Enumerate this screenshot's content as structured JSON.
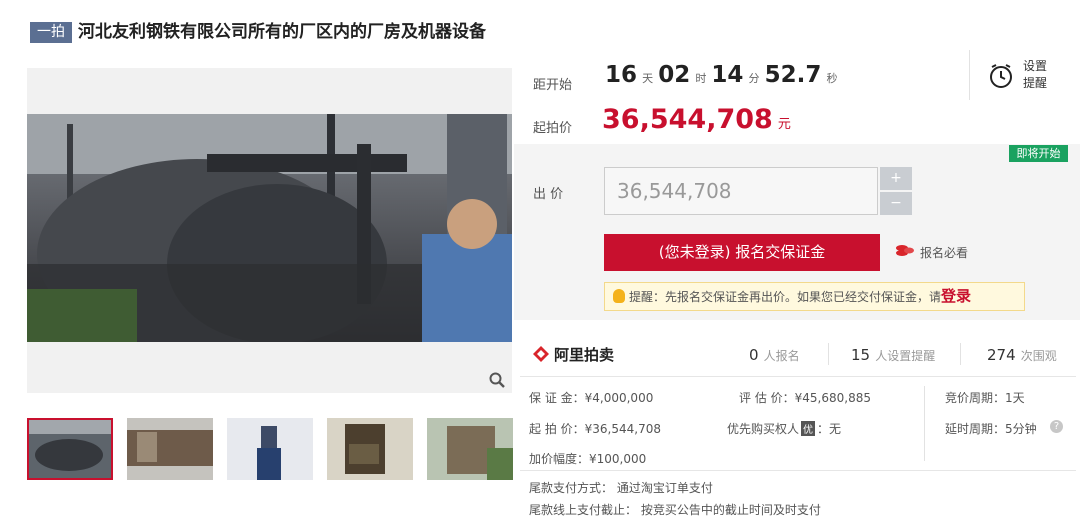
{
  "header": {
    "badge": "一拍",
    "title": "河北友利钢铁有限公司所有的厂区内的厂房及机器设备"
  },
  "countdown": {
    "label": "距开始",
    "days": "16",
    "days_unit": "天",
    "hours": "02",
    "hours_unit": "时",
    "minutes": "14",
    "minutes_unit": "分",
    "seconds": "52.7",
    "seconds_unit": "秒"
  },
  "reminder": {
    "line1": "设置",
    "line2": "提醒"
  },
  "start_price": {
    "label": "起拍价",
    "value": "36,544,708",
    "unit": "元"
  },
  "status_badge": "即将开始",
  "bid": {
    "label": "出 价",
    "input_value": "36,544,708",
    "plus": "+",
    "minus": "−"
  },
  "signup_button": "(您未登录) 报名交保证金",
  "must_read": "报名必看",
  "tip": {
    "text": "提醒：先报名交保证金再出价。如果您已经交付保证金，请",
    "login": "登录"
  },
  "brand": "阿里拍卖",
  "stats": [
    {
      "num": "0",
      "unit": "人报名"
    },
    {
      "num": "15",
      "unit": "人设置提醒"
    },
    {
      "num": "274",
      "unit": "次围观"
    }
  ],
  "info": {
    "deposit": "保 证 金：¥4,000,000",
    "appraisal": "评 估 价：¥45,680,885",
    "cycle": "竞价周期：1天",
    "start": "起 拍 价：¥36,544,708",
    "priority": "优先购买权人",
    "priority_badge": "优",
    "priority_value": "：无",
    "delay": "延时周期：5分钟",
    "increment": "加价幅度：¥100,000",
    "pay_method": "尾款支付方式：  通过淘宝订单支付",
    "pay_deadline": "尾款线上支付截止：  按竞买公告中的截止时间及时支付"
  }
}
